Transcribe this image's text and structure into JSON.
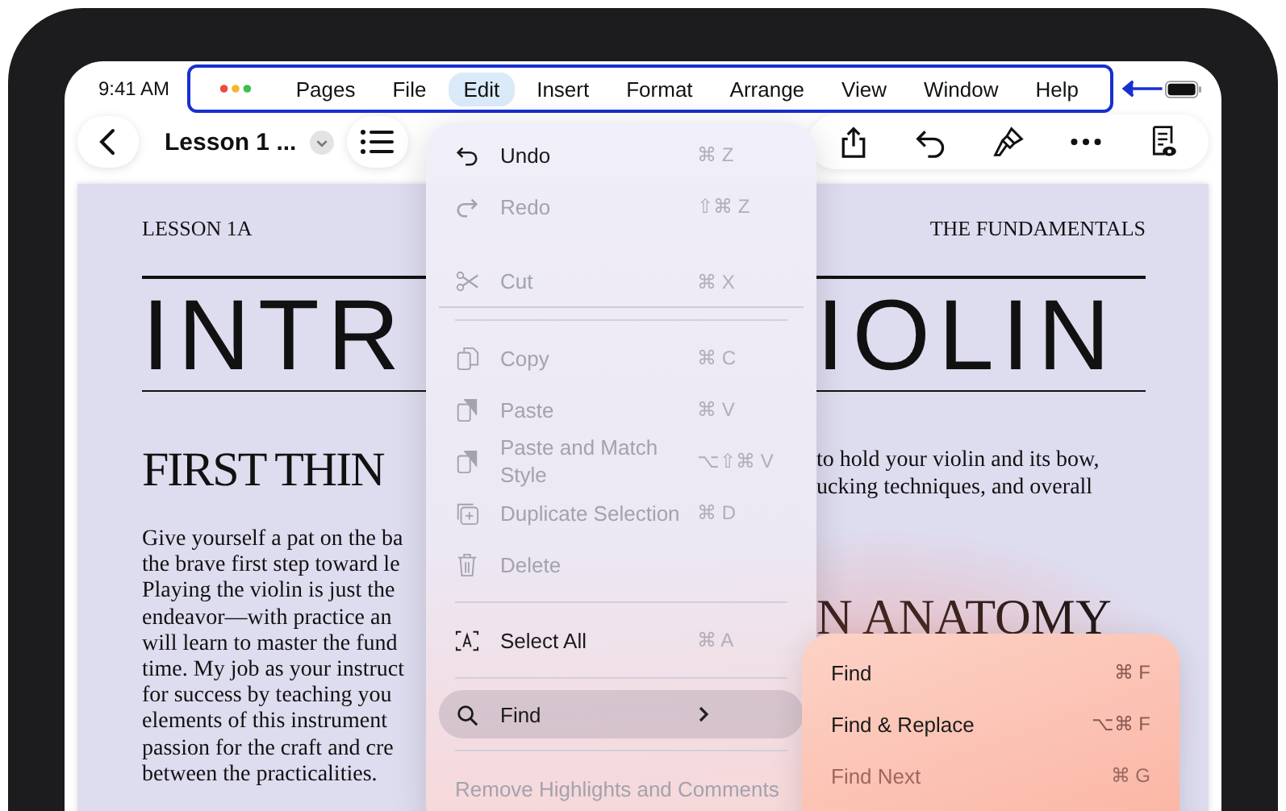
{
  "status_bar": {
    "time": "9:41 AM"
  },
  "menu_bar": {
    "items": [
      {
        "label": "Pages",
        "selected": false
      },
      {
        "label": "File",
        "selected": false
      },
      {
        "label": "Edit",
        "selected": true
      },
      {
        "label": "Insert",
        "selected": false
      },
      {
        "label": "Format",
        "selected": false
      },
      {
        "label": "Arrange",
        "selected": false
      },
      {
        "label": "View",
        "selected": false
      },
      {
        "label": "Window",
        "selected": false
      },
      {
        "label": "Help",
        "selected": false
      }
    ]
  },
  "toolbar": {
    "document_title": "Lesson 1 ..."
  },
  "document": {
    "header_left": "LESSON 1A",
    "header_right": "THE FUNDAMENTALS",
    "title_left": "INTR",
    "title_right": "IOLIN",
    "subheading_left": "FIRST THIN",
    "subheading_right": "N ANATOMY",
    "body_left": [
      "Give yourself a pat on the ba",
      "the brave first step toward le",
      "Playing the violin is just the",
      "endeavor—with practice an",
      "will learn to master the fund",
      "time. My job as your instruct",
      "for success by teaching you",
      "elements of this instrument",
      "passion for the craft and cre",
      "between the practicalities."
    ],
    "body_right": [
      "to hold your violin and its bow,",
      "ucking techniques, and overall"
    ]
  },
  "edit_menu": {
    "sections": [
      [
        {
          "kind": "action",
          "label": "Undo",
          "shortcut": "⌘ Z",
          "disabled": false,
          "selected": false
        },
        {
          "kind": "action",
          "label": "Redo",
          "shortcut": "⇧⌘ Z",
          "disabled": true,
          "selected": false
        },
        {
          "kind": "action",
          "label": "Cut",
          "shortcut": "⌘ X",
          "disabled": true,
          "selected": false
        }
      ],
      [
        {
          "kind": "action",
          "label": "Copy",
          "shortcut": "⌘ C",
          "disabled": true,
          "selected": false
        },
        {
          "kind": "action",
          "label": "Paste",
          "shortcut": "⌘ V",
          "disabled": true,
          "selected": false
        },
        {
          "kind": "action",
          "label": "Paste and Match Style",
          "shortcut": "⌥⇧⌘ V",
          "disabled": true,
          "selected": false
        },
        {
          "kind": "action",
          "label": "Duplicate Selection",
          "shortcut": "⌘ D",
          "disabled": true,
          "selected": false
        },
        {
          "kind": "action",
          "label": "Delete",
          "disabled": true,
          "selected": false
        }
      ],
      [
        {
          "kind": "action",
          "label": "Select All",
          "shortcut": "⌘ A",
          "disabled": false,
          "selected": false
        }
      ],
      [
        {
          "kind": "submenu",
          "label": "Find",
          "disabled": false,
          "selected": true
        }
      ],
      [
        {
          "kind": "action",
          "label": "Remove Highlights and Comments",
          "disabled": true,
          "selected": false
        }
      ]
    ]
  },
  "find_submenu": {
    "items": [
      {
        "label": "Find",
        "shortcut": "⌘ F",
        "disabled": false
      },
      {
        "label": "Find & Replace",
        "shortcut": "⌥⌘ F",
        "disabled": false
      },
      {
        "label": "Find Next",
        "shortcut": "⌘ G",
        "disabled": true
      }
    ]
  }
}
